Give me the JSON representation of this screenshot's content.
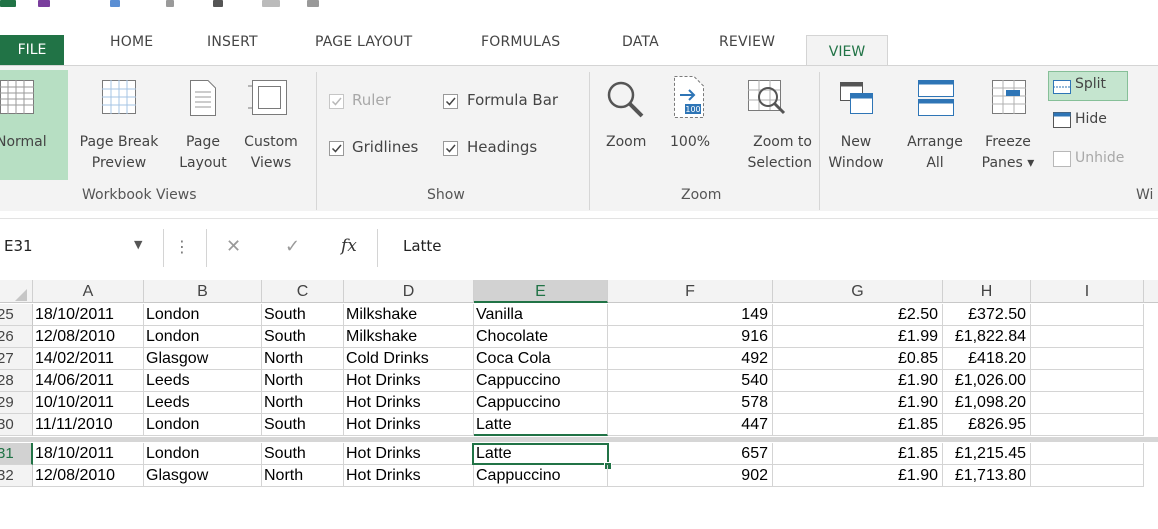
{
  "ribbon_tabs": [
    "FILE",
    "HOME",
    "INSERT",
    "PAGE LAYOUT",
    "FORMULAS",
    "DATA",
    "REVIEW",
    "VIEW"
  ],
  "workbook_views": {
    "normal": "Normal",
    "page_break_1": "Page Break",
    "page_break_2": "Preview",
    "page_layout_1": "Page",
    "page_layout_2": "Layout",
    "custom_views_1": "Custom",
    "custom_views_2": "Views",
    "group_label": "Workbook Views"
  },
  "show": {
    "ruler": "Ruler",
    "formula_bar": "Formula Bar",
    "gridlines": "Gridlines",
    "headings": "Headings",
    "group_label": "Show"
  },
  "zoom": {
    "zoom": "Zoom",
    "hundred": "100%",
    "hundred_icon": "100",
    "zoom_sel_1": "Zoom to",
    "zoom_sel_2": "Selection",
    "group_label": "Zoom"
  },
  "window": {
    "new_1": "New",
    "new_2": "Window",
    "arrange_1": "Arrange",
    "arrange_2": "All",
    "freeze_1": "Freeze",
    "freeze_2": "Panes",
    "split": "Split",
    "hide": "Hide",
    "unhide": "Unhide",
    "group_label": "Wi"
  },
  "formula_bar": {
    "name_box": "E31",
    "fx": "fx",
    "value": "Latte"
  },
  "columns": [
    "A",
    "B",
    "C",
    "D",
    "E",
    "F",
    "G",
    "H",
    "I"
  ],
  "rows": [
    {
      "n": "25",
      "a": "18/10/2011",
      "b": "London",
      "c": "South",
      "d": "Milkshake",
      "e": "Vanilla",
      "f": "149",
      "g": "£2.50",
      "h": "£372.50"
    },
    {
      "n": "26",
      "a": "12/08/2010",
      "b": "London",
      "c": "South",
      "d": "Milkshake",
      "e": "Chocolate",
      "f": "916",
      "g": "£1.99",
      "h": "£1,822.84"
    },
    {
      "n": "27",
      "a": "14/02/2011",
      "b": "Glasgow",
      "c": "North",
      "d": "Cold Drinks",
      "e": "Coca Cola",
      "f": "492",
      "g": "£0.85",
      "h": "£418.20"
    },
    {
      "n": "28",
      "a": "14/06/2011",
      "b": "Leeds",
      "c": "North",
      "d": "Hot Drinks",
      "e": "Cappuccino",
      "f": "540",
      "g": "£1.90",
      "h": "£1,026.00"
    },
    {
      "n": "29",
      "a": "10/10/2011",
      "b": "Leeds",
      "c": "North",
      "d": "Hot Drinks",
      "e": "Cappuccino",
      "f": "578",
      "g": "£1.90",
      "h": "£1,098.20"
    },
    {
      "n": "30",
      "a": "11/11/2010",
      "b": "London",
      "c": "South",
      "d": "Hot Drinks",
      "e": "Latte",
      "f": "447",
      "g": "£1.85",
      "h": "£826.95"
    },
    {
      "n": "31",
      "a": "18/10/2011",
      "b": "London",
      "c": "South",
      "d": "Hot Drinks",
      "e": "Latte",
      "f": "657",
      "g": "£1.85",
      "h": "£1,215.45"
    },
    {
      "n": "32",
      "a": "12/08/2010",
      "b": "Glasgow",
      "c": "North",
      "d": "Hot Drinks",
      "e": "Cappuccino",
      "f": "902",
      "g": "£1.90",
      "h": "£1,713.80"
    }
  ],
  "colors": {
    "accent": "#217346",
    "split_active": "#c5e5cf",
    "normal_active": "#b7dfc3"
  }
}
